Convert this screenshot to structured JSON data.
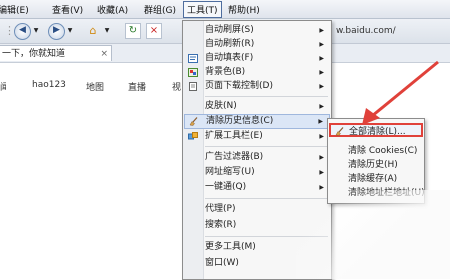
{
  "menubar": {
    "items": [
      {
        "label": "编辑(E)"
      },
      {
        "label": "查看(V)"
      },
      {
        "label": "收藏(A)"
      },
      {
        "label": "群组(G)"
      },
      {
        "label": "工具(T)"
      },
      {
        "label": "帮助(H)"
      }
    ]
  },
  "toolbar": {
    "close_label": "×",
    "refresh_label": "↻"
  },
  "address": {
    "value": "w.baidu.com/"
  },
  "tab": {
    "title": "一下，你就知道",
    "close": "×"
  },
  "page": {
    "nav_links": [
      "hao123",
      "地图",
      "直播",
      "视"
    ]
  },
  "tools_menu": {
    "items": [
      {
        "label": "自动刷屏(S)",
        "submenu": true
      },
      {
        "label": "自动刷新(R)",
        "submenu": true
      },
      {
        "label": "自动填表(F)",
        "submenu": true
      },
      {
        "label": "背景色(B)",
        "submenu": true
      },
      {
        "label": "页面下载控制(D)",
        "submenu": true
      },
      {
        "label": "皮肤(N)",
        "submenu": true
      },
      {
        "label": "清除历史信息(C)",
        "submenu": true
      },
      {
        "label": "扩展工具栏(E)",
        "submenu": true
      },
      {
        "label": "广告过滤器(B)",
        "submenu": true
      },
      {
        "label": "网址缩写(U)",
        "submenu": true
      },
      {
        "label": "一键通(Q)",
        "submenu": true
      },
      {
        "label": "代理(P)",
        "submenu": false
      },
      {
        "label": "搜索(R)",
        "submenu": false
      },
      {
        "label": "更多工具(M)",
        "submenu": false
      },
      {
        "label": "窗口(W)",
        "submenu": false
      }
    ]
  },
  "clear_history_submenu": {
    "items": [
      {
        "label": "全部清除(L)..."
      },
      {
        "label": "清除 Cookies(C)"
      },
      {
        "label": "清除历史(H)"
      },
      {
        "label": "清除缓存(A)"
      },
      {
        "label": "清除地址栏地址(U)"
      }
    ]
  },
  "colors": {
    "highlight_border": "#e0413a",
    "menu_hover": "#dbe6f6",
    "arrow": "#e0413a"
  },
  "icons": {
    "back": "back-arrow-icon",
    "forward": "forward-arrow-icon",
    "home": "home-icon",
    "refresh": "refresh-icon",
    "stop": "stop-icon",
    "broom": "broom-icon"
  }
}
